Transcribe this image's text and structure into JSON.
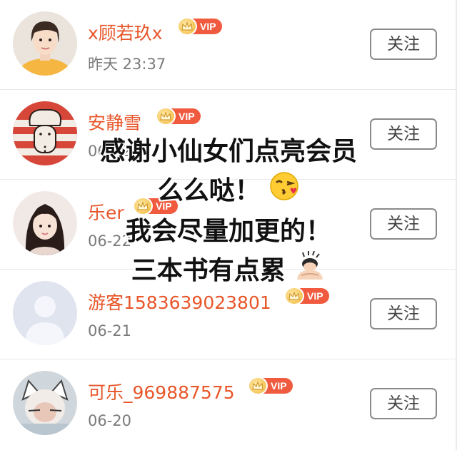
{
  "list": {
    "follow_label": "关注",
    "vip_label": "VIP",
    "users": [
      {
        "name": "x顾若玖x",
        "time": "昨天 23:37"
      },
      {
        "name": "安静雪",
        "time": "06-22"
      },
      {
        "name": "乐er",
        "time": "06-22"
      },
      {
        "name": "游客1583639023801",
        "time": "06-21"
      },
      {
        "name": "可乐_969887575",
        "time": "06-20"
      }
    ]
  },
  "overlay": {
    "line1": "感谢小仙女们点亮会员",
    "line2": "么么哒！",
    "line3": "我会尽量加更的！",
    "line4": "三本书有点累"
  },
  "colors": {
    "name": "#e8562a",
    "vip_tag": "#f05a3e",
    "time": "#7a7a7a",
    "button_border": "#8a8a8a"
  },
  "icons": {
    "overlay_emoji_1": "kissing-face-emoji",
    "overlay_emoji_2": "person-bowing-emoji",
    "vip_badge": "crown-icon"
  }
}
